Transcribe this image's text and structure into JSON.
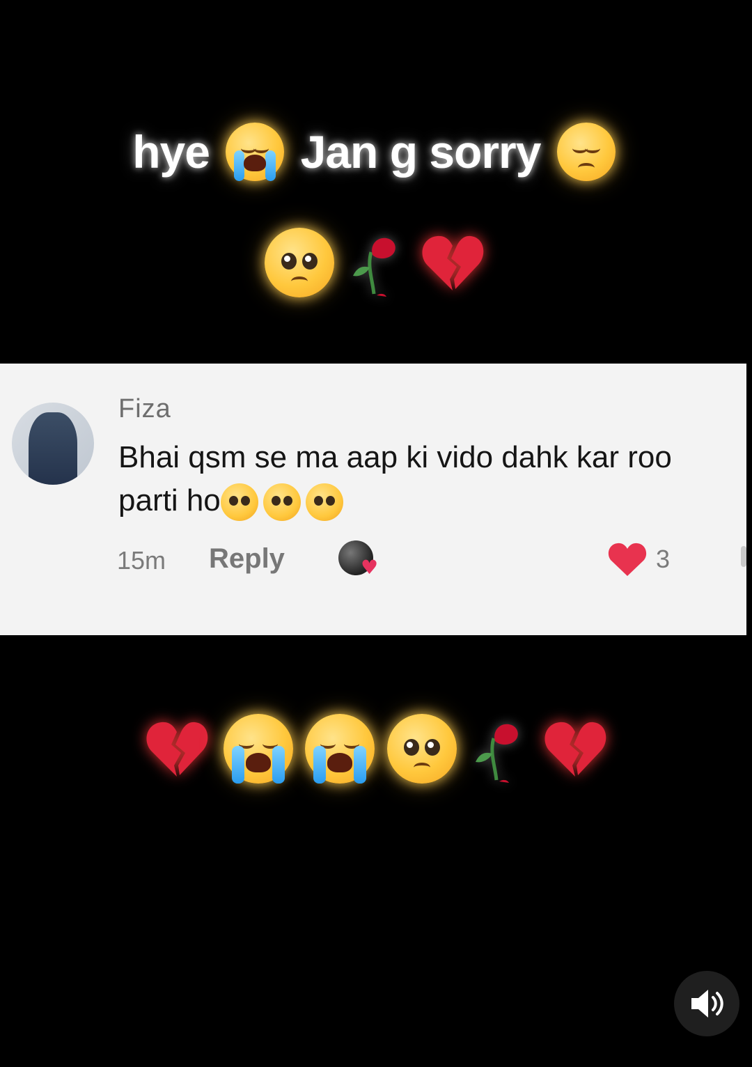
{
  "headline": {
    "word1": "hye",
    "word2": "Jan g sorry"
  },
  "icons": {
    "headline_emoji_1": "loudly-crying-face-icon",
    "headline_emoji_2": "pensive-face-icon",
    "row_1": [
      "pleading-face-icon",
      "wilted-rose-icon",
      "broken-heart-icon"
    ],
    "row_2": [
      "broken-heart-icon",
      "loudly-crying-face-icon",
      "loudly-crying-face-icon",
      "pleading-face-icon",
      "wilted-rose-icon",
      "broken-heart-icon"
    ],
    "sound": "speaker-icon"
  },
  "comment": {
    "username": "Fiza",
    "text_line1": "Bhai qsm se ma aap ki vido dahk kar roo",
    "text_line2": "parti ho",
    "text_emojis": [
      "pleading-face-icon",
      "pleading-face-icon",
      "pleading-face-icon"
    ],
    "time": "15m",
    "reply_label": "Reply",
    "like_count": "3"
  },
  "colors": {
    "background": "#000000",
    "card": "#f3f3f3",
    "like_heart": "#e8334f",
    "secondary_text": "#7a7a7a"
  }
}
